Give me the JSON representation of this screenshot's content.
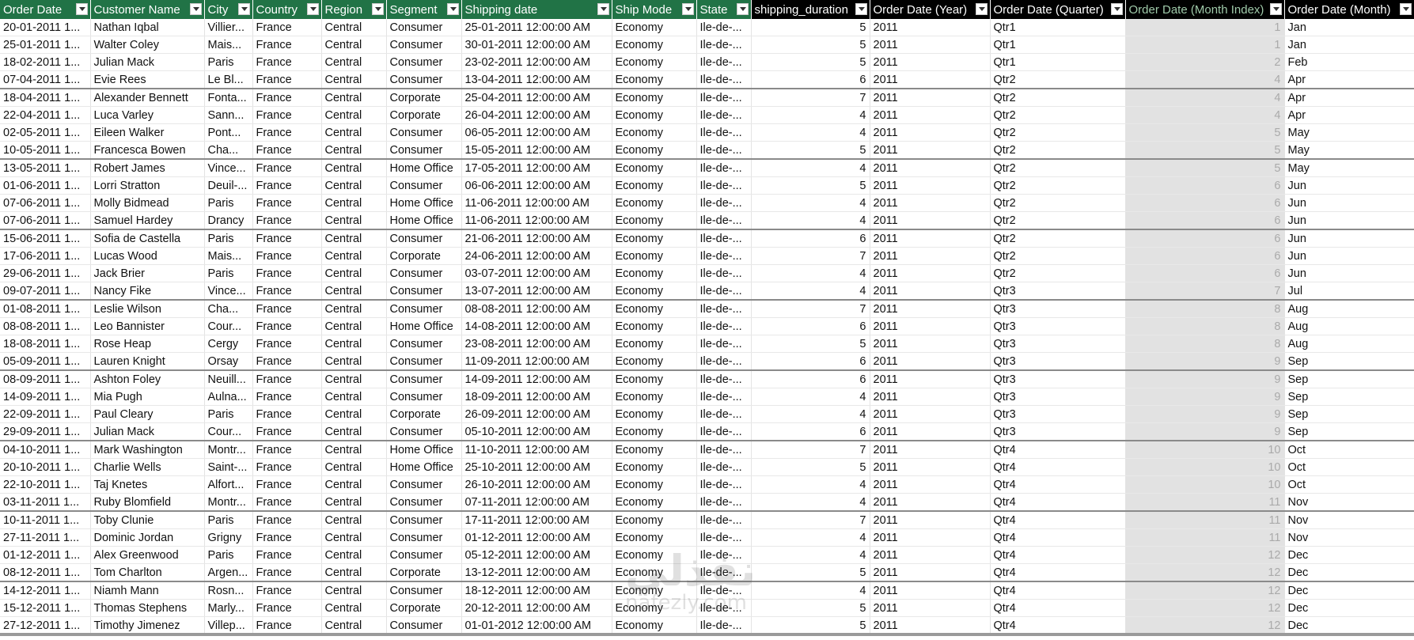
{
  "headers": [
    {
      "label": "Order Date",
      "style": "green"
    },
    {
      "label": "Customer Name",
      "style": "green"
    },
    {
      "label": "City",
      "style": "green"
    },
    {
      "label": "Country",
      "style": "green"
    },
    {
      "label": "Region",
      "style": "green"
    },
    {
      "label": "Segment",
      "style": "green"
    },
    {
      "label": "Shipping date",
      "style": "green"
    },
    {
      "label": "Ship Mode",
      "style": "green"
    },
    {
      "label": "State",
      "style": "green"
    },
    {
      "label": "shipping_duration",
      "style": "black"
    },
    {
      "label": "Order Date (Year)",
      "style": "black"
    },
    {
      "label": "Order Date (Quarter)",
      "style": "black"
    },
    {
      "label": "Order Date (Month Index)",
      "style": "black-dim"
    },
    {
      "label": "Order Date (Month)",
      "style": "black"
    }
  ],
  "rows": [
    [
      "20-01-2011 1...",
      "Nathan Iqbal",
      "Villier...",
      "France",
      "Central",
      "Consumer",
      "25-01-2011 12:00:00 AM",
      "Economy",
      "Ile-de-...",
      "5",
      "2011",
      "Qtr1",
      "1",
      "Jan"
    ],
    [
      "25-01-2011 1...",
      "Walter Coley",
      "Mais...",
      "France",
      "Central",
      "Consumer",
      "30-01-2011 12:00:00 AM",
      "Economy",
      "Ile-de-...",
      "5",
      "2011",
      "Qtr1",
      "1",
      "Jan"
    ],
    [
      "18-02-2011 1...",
      "Julian Mack",
      "Paris",
      "France",
      "Central",
      "Consumer",
      "23-02-2011 12:00:00 AM",
      "Economy",
      "Ile-de-...",
      "5",
      "2011",
      "Qtr1",
      "2",
      "Feb"
    ],
    [
      "07-04-2011 1...",
      "Evie Rees",
      "Le Bl...",
      "France",
      "Central",
      "Consumer",
      "13-04-2011 12:00:00 AM",
      "Economy",
      "Ile-de-...",
      "6",
      "2011",
      "Qtr2",
      "4",
      "Apr"
    ],
    [
      "18-04-2011 1...",
      "Alexander Bennett",
      "Fonta...",
      "France",
      "Central",
      "Corporate",
      "25-04-2011 12:00:00 AM",
      "Economy",
      "Ile-de-...",
      "7",
      "2011",
      "Qtr2",
      "4",
      "Apr"
    ],
    [
      "22-04-2011 1...",
      "Luca Varley",
      "Sann...",
      "France",
      "Central",
      "Corporate",
      "26-04-2011 12:00:00 AM",
      "Economy",
      "Ile-de-...",
      "4",
      "2011",
      "Qtr2",
      "4",
      "Apr"
    ],
    [
      "02-05-2011 1...",
      "Eileen Walker",
      "Pont...",
      "France",
      "Central",
      "Consumer",
      "06-05-2011 12:00:00 AM",
      "Economy",
      "Ile-de-...",
      "4",
      "2011",
      "Qtr2",
      "5",
      "May"
    ],
    [
      "10-05-2011 1...",
      "Francesca Bowen",
      "Cha...",
      "France",
      "Central",
      "Consumer",
      "15-05-2011 12:00:00 AM",
      "Economy",
      "Ile-de-...",
      "5",
      "2011",
      "Qtr2",
      "5",
      "May"
    ],
    [
      "13-05-2011 1...",
      "Robert James",
      "Vince...",
      "France",
      "Central",
      "Home Office",
      "17-05-2011 12:00:00 AM",
      "Economy",
      "Ile-de-...",
      "4",
      "2011",
      "Qtr2",
      "5",
      "May"
    ],
    [
      "01-06-2011 1...",
      "Lorri Stratton",
      "Deuil-...",
      "France",
      "Central",
      "Consumer",
      "06-06-2011 12:00:00 AM",
      "Economy",
      "Ile-de-...",
      "5",
      "2011",
      "Qtr2",
      "6",
      "Jun"
    ],
    [
      "07-06-2011 1...",
      "Molly Bidmead",
      "Paris",
      "France",
      "Central",
      "Home Office",
      "11-06-2011 12:00:00 AM",
      "Economy",
      "Ile-de-...",
      "4",
      "2011",
      "Qtr2",
      "6",
      "Jun"
    ],
    [
      "07-06-2011 1...",
      "Samuel Hardey",
      "Drancy",
      "France",
      "Central",
      "Home Office",
      "11-06-2011 12:00:00 AM",
      "Economy",
      "Ile-de-...",
      "4",
      "2011",
      "Qtr2",
      "6",
      "Jun"
    ],
    [
      "15-06-2011 1...",
      "Sofia de Castella",
      "Paris",
      "France",
      "Central",
      "Consumer",
      "21-06-2011 12:00:00 AM",
      "Economy",
      "Ile-de-...",
      "6",
      "2011",
      "Qtr2",
      "6",
      "Jun"
    ],
    [
      "17-06-2011 1...",
      "Lucas Wood",
      "Mais...",
      "France",
      "Central",
      "Corporate",
      "24-06-2011 12:00:00 AM",
      "Economy",
      "Ile-de-...",
      "7",
      "2011",
      "Qtr2",
      "6",
      "Jun"
    ],
    [
      "29-06-2011 1...",
      "Jack Brier",
      "Paris",
      "France",
      "Central",
      "Consumer",
      "03-07-2011 12:00:00 AM",
      "Economy",
      "Ile-de-...",
      "4",
      "2011",
      "Qtr2",
      "6",
      "Jun"
    ],
    [
      "09-07-2011 1...",
      "Nancy Fike",
      "Vince...",
      "France",
      "Central",
      "Consumer",
      "13-07-2011 12:00:00 AM",
      "Economy",
      "Ile-de-...",
      "4",
      "2011",
      "Qtr3",
      "7",
      "Jul"
    ],
    [
      "01-08-2011 1...",
      "Leslie Wilson",
      "Cha...",
      "France",
      "Central",
      "Consumer",
      "08-08-2011 12:00:00 AM",
      "Economy",
      "Ile-de-...",
      "7",
      "2011",
      "Qtr3",
      "8",
      "Aug"
    ],
    [
      "08-08-2011 1...",
      "Leo Bannister",
      "Cour...",
      "France",
      "Central",
      "Home Office",
      "14-08-2011 12:00:00 AM",
      "Economy",
      "Ile-de-...",
      "6",
      "2011",
      "Qtr3",
      "8",
      "Aug"
    ],
    [
      "18-08-2011 1...",
      "Rose Heap",
      "Cergy",
      "France",
      "Central",
      "Consumer",
      "23-08-2011 12:00:00 AM",
      "Economy",
      "Ile-de-...",
      "5",
      "2011",
      "Qtr3",
      "8",
      "Aug"
    ],
    [
      "05-09-2011 1...",
      "Lauren Knight",
      "Orsay",
      "France",
      "Central",
      "Consumer",
      "11-09-2011 12:00:00 AM",
      "Economy",
      "Ile-de-...",
      "6",
      "2011",
      "Qtr3",
      "9",
      "Sep"
    ],
    [
      "08-09-2011 1...",
      "Ashton Foley",
      "Neuill...",
      "France",
      "Central",
      "Consumer",
      "14-09-2011 12:00:00 AM",
      "Economy",
      "Ile-de-...",
      "6",
      "2011",
      "Qtr3",
      "9",
      "Sep"
    ],
    [
      "14-09-2011 1...",
      "Mia Pugh",
      "Aulna...",
      "France",
      "Central",
      "Consumer",
      "18-09-2011 12:00:00 AM",
      "Economy",
      "Ile-de-...",
      "4",
      "2011",
      "Qtr3",
      "9",
      "Sep"
    ],
    [
      "22-09-2011 1...",
      "Paul Cleary",
      "Paris",
      "France",
      "Central",
      "Corporate",
      "26-09-2011 12:00:00 AM",
      "Economy",
      "Ile-de-...",
      "4",
      "2011",
      "Qtr3",
      "9",
      "Sep"
    ],
    [
      "29-09-2011 1...",
      "Julian Mack",
      "Cour...",
      "France",
      "Central",
      "Consumer",
      "05-10-2011 12:00:00 AM",
      "Economy",
      "Ile-de-...",
      "6",
      "2011",
      "Qtr3",
      "9",
      "Sep"
    ],
    [
      "04-10-2011 1...",
      "Mark Washington",
      "Montr...",
      "France",
      "Central",
      "Home Office",
      "11-10-2011 12:00:00 AM",
      "Economy",
      "Ile-de-...",
      "7",
      "2011",
      "Qtr4",
      "10",
      "Oct"
    ],
    [
      "20-10-2011 1...",
      "Charlie Wells",
      "Saint-...",
      "France",
      "Central",
      "Home Office",
      "25-10-2011 12:00:00 AM",
      "Economy",
      "Ile-de-...",
      "5",
      "2011",
      "Qtr4",
      "10",
      "Oct"
    ],
    [
      "22-10-2011 1...",
      "Taj Knetes",
      "Alfort...",
      "France",
      "Central",
      "Consumer",
      "26-10-2011 12:00:00 AM",
      "Economy",
      "Ile-de-...",
      "4",
      "2011",
      "Qtr4",
      "10",
      "Oct"
    ],
    [
      "03-11-2011 1...",
      "Ruby Blomfield",
      "Montr...",
      "France",
      "Central",
      "Consumer",
      "07-11-2011 12:00:00 AM",
      "Economy",
      "Ile-de-...",
      "4",
      "2011",
      "Qtr4",
      "11",
      "Nov"
    ],
    [
      "10-11-2011 1...",
      "Toby Clunie",
      "Paris",
      "France",
      "Central",
      "Consumer",
      "17-11-2011 12:00:00 AM",
      "Economy",
      "Ile-de-...",
      "7",
      "2011",
      "Qtr4",
      "11",
      "Nov"
    ],
    [
      "27-11-2011 1...",
      "Dominic Jordan",
      "Grigny",
      "France",
      "Central",
      "Consumer",
      "01-12-2011 12:00:00 AM",
      "Economy",
      "Ile-de-...",
      "4",
      "2011",
      "Qtr4",
      "11",
      "Nov"
    ],
    [
      "01-12-2011 1...",
      "Alex Greenwood",
      "Paris",
      "France",
      "Central",
      "Consumer",
      "05-12-2011 12:00:00 AM",
      "Economy",
      "Ile-de-...",
      "4",
      "2011",
      "Qtr4",
      "12",
      "Dec"
    ],
    [
      "08-12-2011 1...",
      "Tom Charlton",
      "Argen...",
      "France",
      "Central",
      "Corporate",
      "13-12-2011 12:00:00 AM",
      "Economy",
      "Ile-de-...",
      "5",
      "2011",
      "Qtr4",
      "12",
      "Dec"
    ],
    [
      "14-12-2011 1...",
      "Niamh Mann",
      "Rosn...",
      "France",
      "Central",
      "Consumer",
      "18-12-2011 12:00:00 AM",
      "Economy",
      "Ile-de-...",
      "4",
      "2011",
      "Qtr4",
      "12",
      "Dec"
    ],
    [
      "15-12-2011 1...",
      "Thomas Stephens",
      "Marly...",
      "France",
      "Central",
      "Corporate",
      "20-12-2011 12:00:00 AM",
      "Economy",
      "Ile-de-...",
      "5",
      "2011",
      "Qtr4",
      "12",
      "Dec"
    ],
    [
      "27-12-2011 1...",
      "Timothy Jimenez",
      "Villep...",
      "France",
      "Central",
      "Consumer",
      "01-01-2012 12:00:00 AM",
      "Economy",
      "Ile-de-...",
      "5",
      "2011",
      "Qtr4",
      "12",
      "Dec"
    ]
  ],
  "separator_after_rows": [
    4,
    8,
    12,
    16,
    20,
    24,
    28,
    32
  ],
  "watermark": {
    "arabic": "نفذلي",
    "latin": "nafezly.com"
  },
  "colors": {
    "header_green": "#217346",
    "header_black": "#000000",
    "index_column_bg": "#e2e2e2"
  }
}
